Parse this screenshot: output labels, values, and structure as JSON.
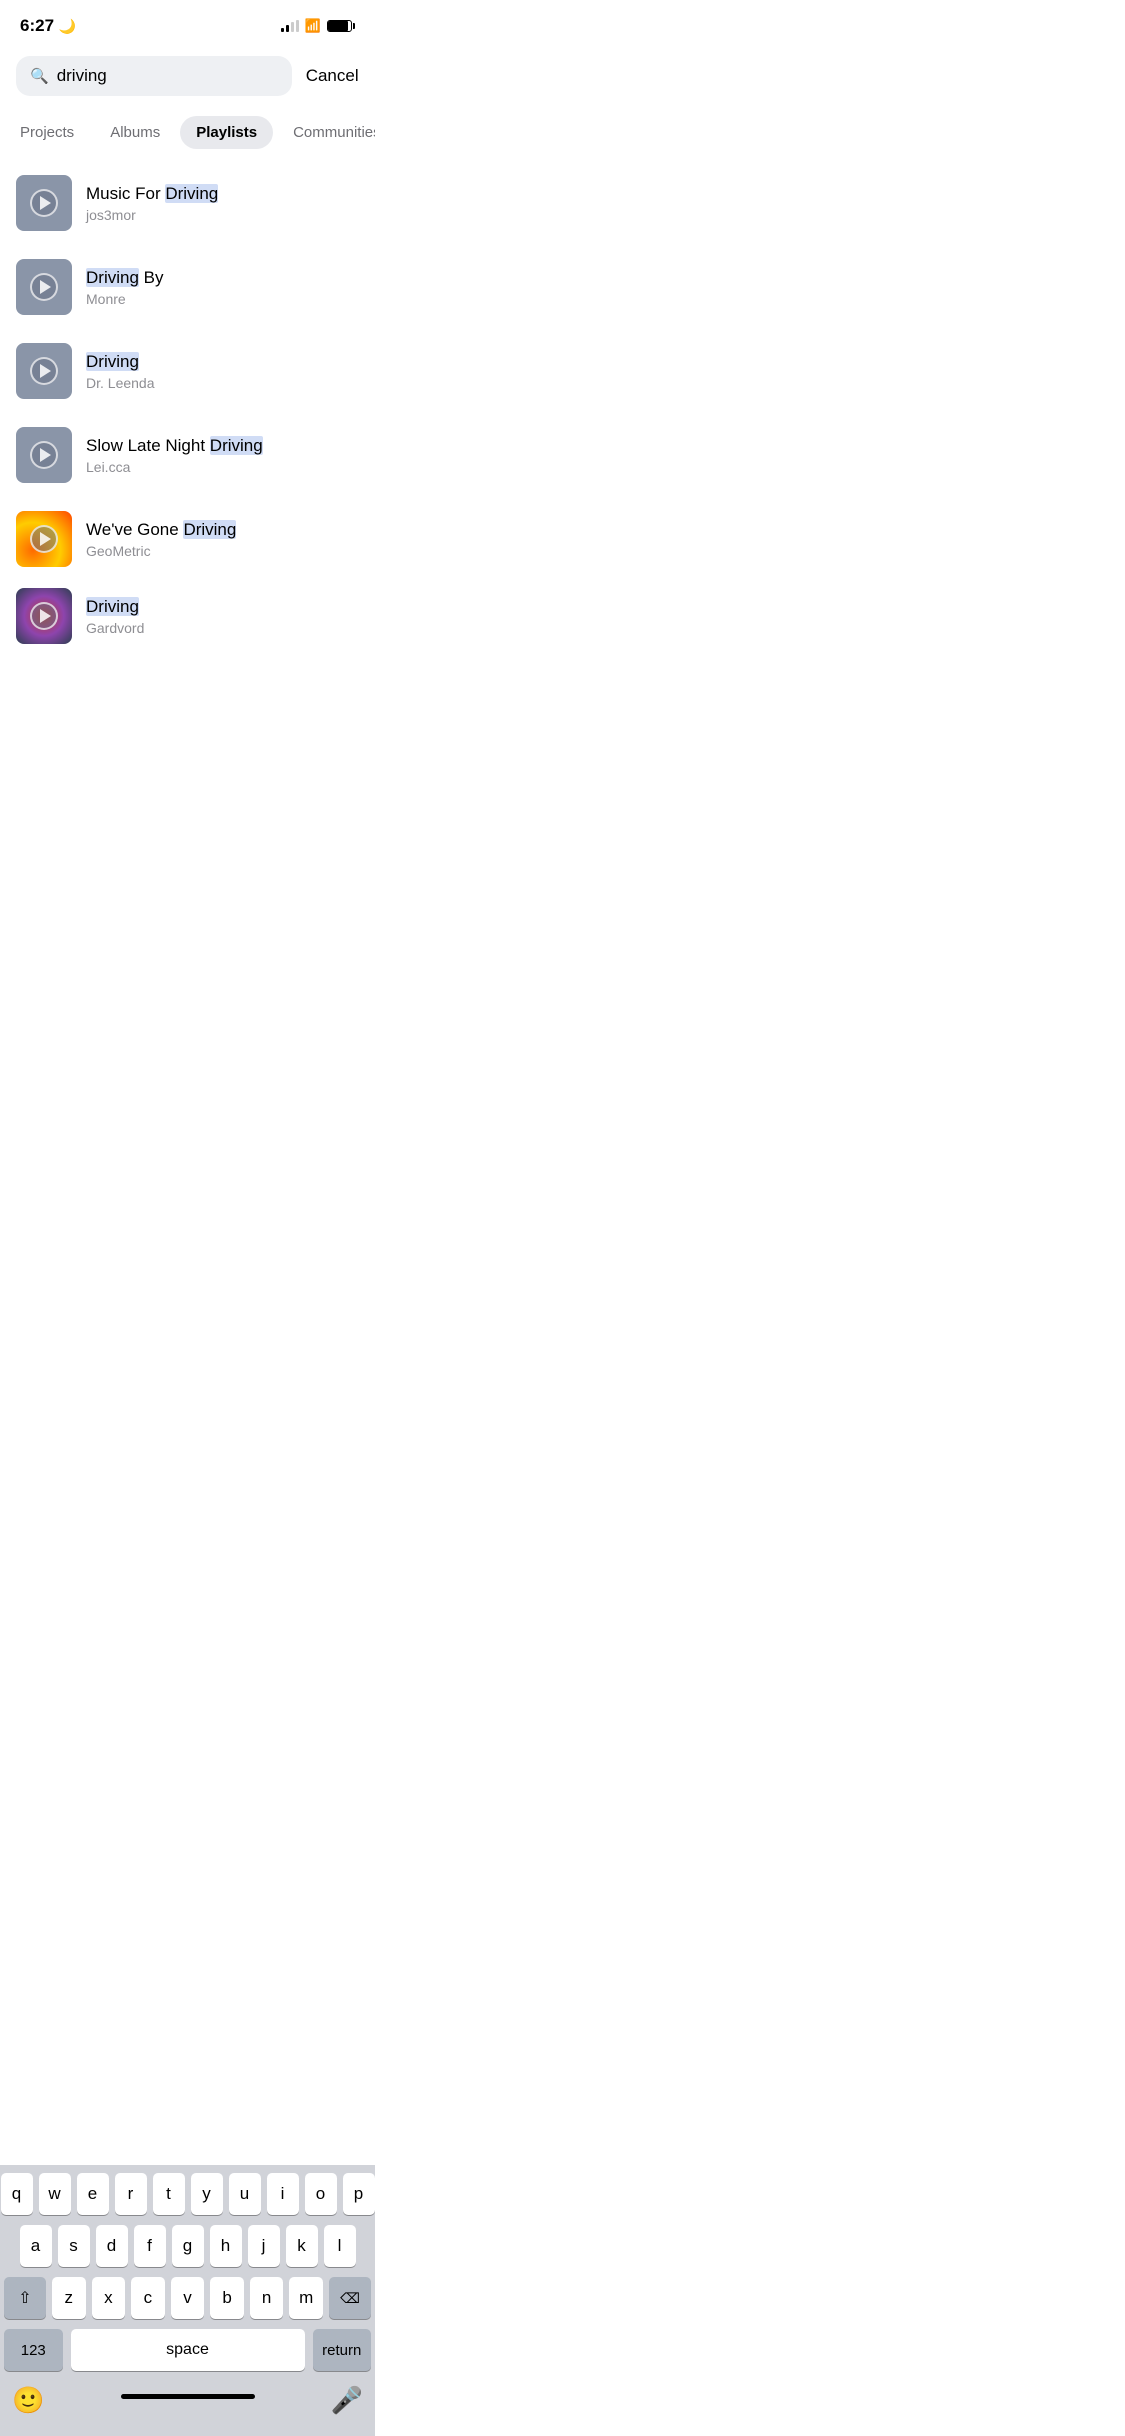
{
  "statusBar": {
    "time": "6:27",
    "moonIcon": "🌙"
  },
  "search": {
    "value": "driving",
    "placeholder": "Search",
    "cancelLabel": "Cancel"
  },
  "filterTabs": [
    {
      "id": "projects",
      "label": "Projects",
      "active": false
    },
    {
      "id": "albums",
      "label": "Albums",
      "active": false
    },
    {
      "id": "playlists",
      "label": "Playlists",
      "active": true
    },
    {
      "id": "communities",
      "label": "Communities",
      "active": false
    }
  ],
  "playlists": [
    {
      "id": 1,
      "titleParts": [
        {
          "text": "Music For ",
          "highlighted": false
        },
        {
          "text": "Driving",
          "highlighted": true
        }
      ],
      "fullTitle": "Music For Driving",
      "creator": "jos3mor",
      "thumbType": "default"
    },
    {
      "id": 2,
      "titleParts": [
        {
          "text": "Driving",
          "highlighted": true
        },
        {
          "text": " By",
          "highlighted": false
        }
      ],
      "fullTitle": "Driving By",
      "creator": "Monre",
      "thumbType": "default"
    },
    {
      "id": 3,
      "titleParts": [
        {
          "text": "Driving",
          "highlighted": true
        }
      ],
      "fullTitle": "Driving",
      "creator": "Dr. Leenda",
      "thumbType": "default"
    },
    {
      "id": 4,
      "titleParts": [
        {
          "text": "Slow Late Night ",
          "highlighted": false
        },
        {
          "text": "Driving",
          "highlighted": true
        }
      ],
      "fullTitle": "Slow Late Night Driving",
      "creator": "Lei.cca",
      "thumbType": "default"
    },
    {
      "id": 5,
      "titleParts": [
        {
          "text": "We've Gone ",
          "highlighted": false
        },
        {
          "text": "Driving",
          "highlighted": true
        }
      ],
      "fullTitle": "We've Gone Driving",
      "creator": "GeoMetric",
      "thumbType": "fire"
    },
    {
      "id": 6,
      "titleParts": [
        {
          "text": "Driving",
          "highlighted": true
        }
      ],
      "fullTitle": "Driving",
      "creator": "Gardvord",
      "thumbType": "cosmos"
    }
  ],
  "keyboard": {
    "rows": [
      [
        "q",
        "w",
        "e",
        "r",
        "t",
        "y",
        "u",
        "i",
        "o",
        "p"
      ],
      [
        "a",
        "s",
        "d",
        "f",
        "g",
        "h",
        "j",
        "k",
        "l"
      ],
      [
        "z",
        "x",
        "c",
        "v",
        "b",
        "n",
        "m"
      ]
    ],
    "numLabel": "123",
    "spaceLabel": "space",
    "returnLabel": "return"
  }
}
